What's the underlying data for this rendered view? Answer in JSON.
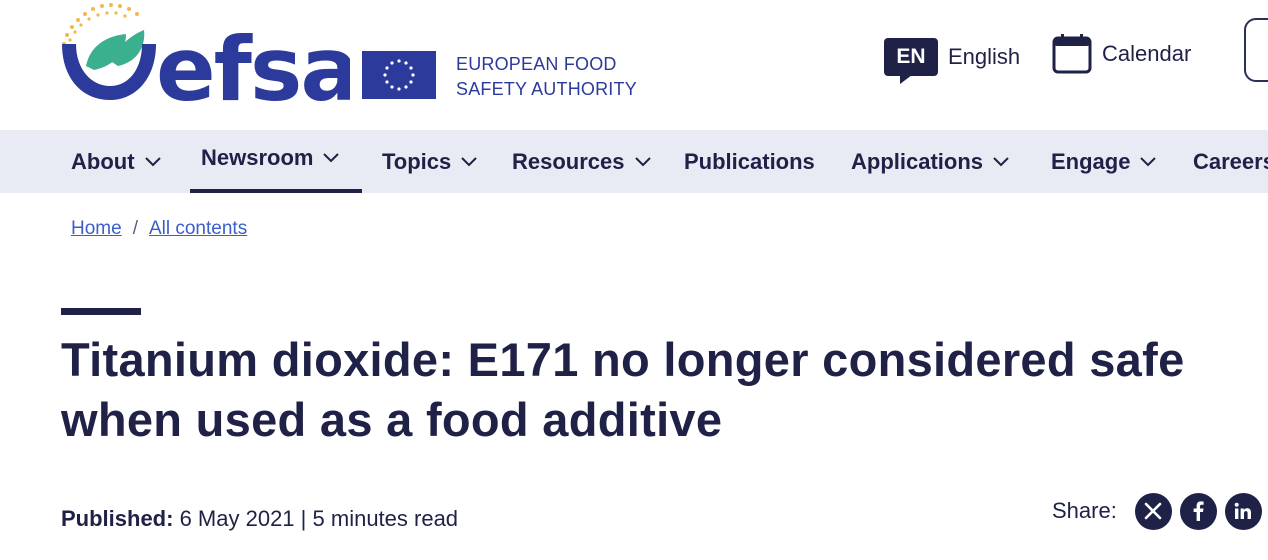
{
  "header": {
    "logo_text": "efsa",
    "agency_name_line1": "EUROPEAN FOOD",
    "agency_name_line2": "SAFETY AUTHORITY",
    "language_code": "EN",
    "language_label": "English",
    "calendar_label": "Calendar"
  },
  "nav": {
    "items": [
      {
        "label": "About",
        "has_dropdown": true
      },
      {
        "label": "Newsroom",
        "has_dropdown": true,
        "active": true
      },
      {
        "label": "Topics",
        "has_dropdown": true
      },
      {
        "label": "Resources",
        "has_dropdown": true
      },
      {
        "label": "Publications",
        "has_dropdown": false
      },
      {
        "label": "Applications",
        "has_dropdown": true
      },
      {
        "label": "Engage",
        "has_dropdown": true
      },
      {
        "label": "Careers",
        "has_dropdown": false
      }
    ]
  },
  "breadcrumb": {
    "home": "Home",
    "separator": "/",
    "current": "All contents"
  },
  "article": {
    "title": "Titanium dioxide: E171 no longer considered safe when used as a food additive",
    "published_label": "Published:",
    "published_date": "6 May 2021",
    "meta_separator": "|",
    "read_time": "5 minutes read"
  },
  "share": {
    "label": "Share:",
    "icons": [
      "x-icon",
      "facebook-icon",
      "linkedin-icon"
    ]
  },
  "colors": {
    "brand_navy": "#1f2147",
    "brand_blue": "#2b3a9b",
    "brand_green": "#3bb08f",
    "brand_gold": "#f2b84b",
    "nav_background": "#e8eaf4",
    "link": "#3d5ec9"
  }
}
